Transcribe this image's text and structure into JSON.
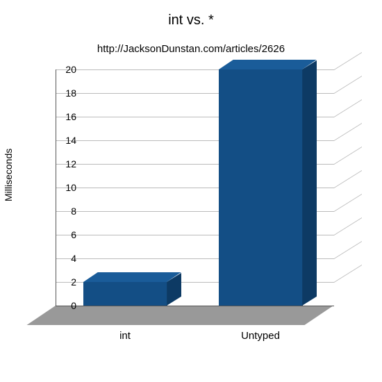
{
  "chart_data": {
    "type": "bar",
    "title": "int vs. *",
    "subtitle": "http://JacksonDunstan.com/articles/2626",
    "ylabel": "Milliseconds",
    "xlabel": "",
    "categories": [
      "int",
      "Untyped"
    ],
    "values": [
      2,
      20
    ],
    "ylim": [
      0,
      20
    ],
    "yticks": [
      0,
      2,
      4,
      6,
      8,
      10,
      12,
      14,
      16,
      18,
      20
    ],
    "bar_color": "#134e85",
    "effect": "3d"
  }
}
